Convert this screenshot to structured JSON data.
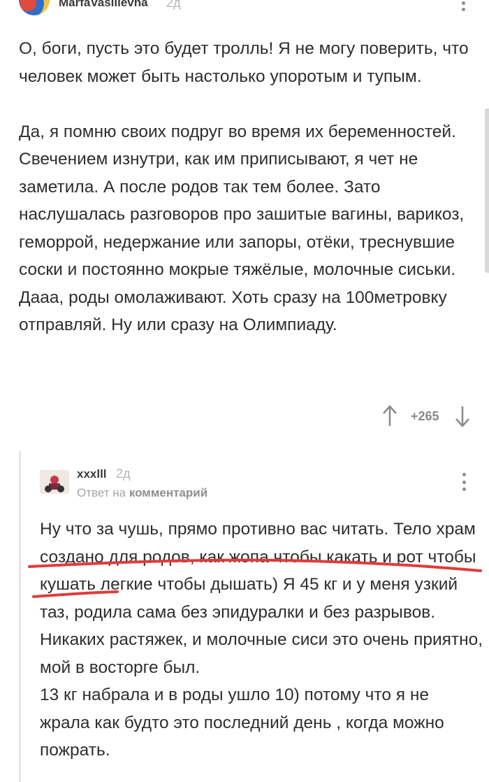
{
  "comment": {
    "author": "MarfaVasilievna",
    "age": "2д",
    "paragraphs": [
      "О, боги, пусть это будет тролль! Я не могу поверить, что человек может быть настолько упоротым и тупым.",
      "Да, я помню своих подруг во время их беременностей. Свечением изнутри, как им приписывают, я чет не заметила. А после родов так тем более. Зато наслушалась разговоров про зашитые вагины, варикоз, геморрой, недержание или запоры, отёки, треснувшие соски и постоянно мокрые тяжёлые, молочные сиськи. Дааа, роды омолаживают. Хоть сразу на 100метровку отправляй. Ну или сразу на Олимпиаду."
    ],
    "rating": "+265"
  },
  "reply": {
    "author": "xxxlll",
    "age": "2д",
    "reply_prefix": "Ответ на",
    "reply_target": "комментарий",
    "text": "Ну что за чушь, прямо противно вас читать. Тело храм создано для родов, как жопа чтобы какать и рот чтобы кушать легкие чтобы дышать) Я 45 кг и у меня узкий таз, родила сама без эпидуралки и без разрывов. Никаких растяжек, и молочные сиси это очень приятно, мой в восторге был.\n13 кг набрала и в роды ушло 10) потому что я не жрала как будто это последний день , когда можно пожрать."
  },
  "colors": {
    "underline": "#e23b3b",
    "text": "#2e2e2e",
    "muted": "#a6a6a6"
  }
}
